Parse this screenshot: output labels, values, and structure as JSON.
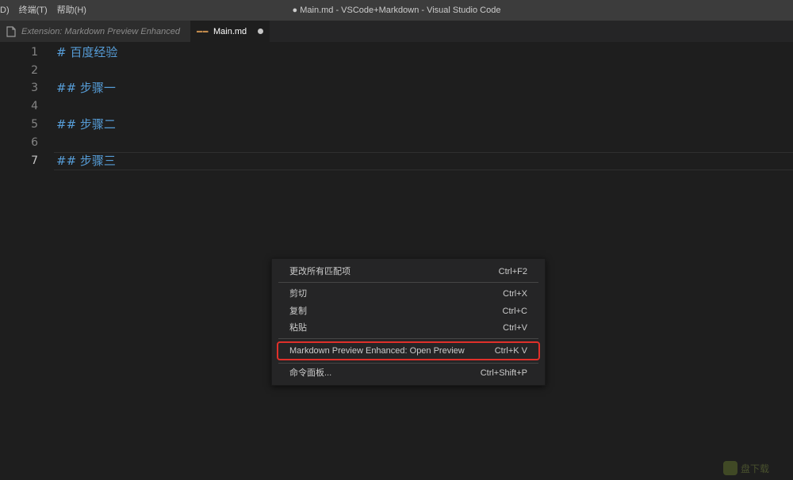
{
  "titlebar": {
    "menu": [
      "D)",
      "终端(T)",
      "帮助(H)"
    ],
    "window_title": "● Main.md - VSCode+Markdown - Visual Studio Code"
  },
  "tabs": [
    {
      "label": "Extension: Markdown Preview Enhanced",
      "active": false,
      "icon": "extension-file-icon"
    },
    {
      "label": "Main.md",
      "active": true,
      "icon": "markdown-file-icon",
      "dirty": true
    }
  ],
  "editor": {
    "current_line": 7,
    "lines": [
      {
        "no": "1",
        "text": "# 百度经验"
      },
      {
        "no": "2",
        "text": ""
      },
      {
        "no": "3",
        "text": "## 步骤一"
      },
      {
        "no": "4",
        "text": ""
      },
      {
        "no": "5",
        "text": "## 步骤二"
      },
      {
        "no": "6",
        "text": ""
      },
      {
        "no": "7",
        "text": "## 步骤三"
      }
    ]
  },
  "context_menu": {
    "items": [
      {
        "label": "更改所有匹配项",
        "shortcut": "Ctrl+F2"
      },
      {
        "label": "剪切",
        "shortcut": "Ctrl+X"
      },
      {
        "label": "复制",
        "shortcut": "Ctrl+C"
      },
      {
        "label": "粘贴",
        "shortcut": "Ctrl+V"
      },
      {
        "label": "Markdown Preview Enhanced: Open Preview",
        "shortcut": "Ctrl+K V",
        "highlighted": true
      },
      {
        "label": "命令面板...",
        "shortcut": "Ctrl+Shift+P"
      }
    ]
  },
  "watermark": {
    "text": "盘下载"
  },
  "colors": {
    "editor_bg": "#1e1e1e",
    "heading_text": "#569cd6",
    "highlight_outline": "#e0302a"
  }
}
